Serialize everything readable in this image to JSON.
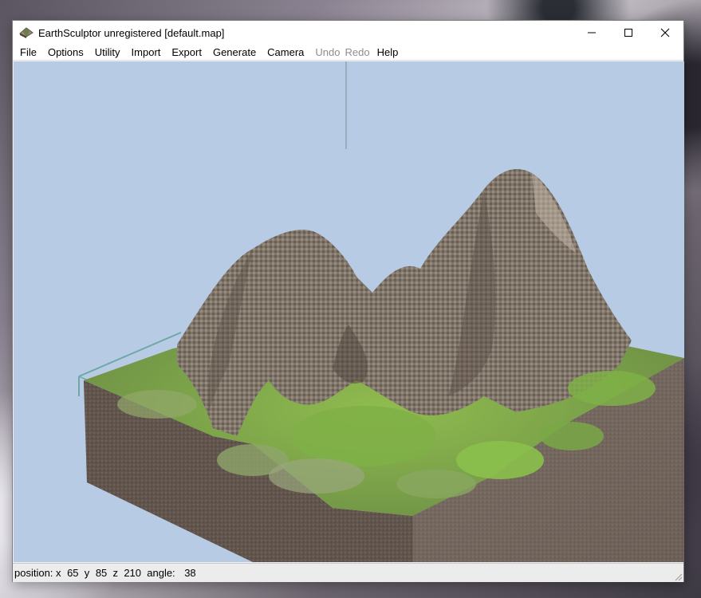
{
  "window": {
    "title": "EarthSculptor unregistered [default.map]",
    "app_icon": "earthsculptor-app-icon"
  },
  "window_controls": {
    "minimize_icon": "minimize-icon",
    "maximize_icon": "maximize-icon",
    "close_icon": "close-icon"
  },
  "menu": {
    "file": "File",
    "options": "Options",
    "utility": "Utility",
    "import": "Import",
    "export": "Export",
    "generate": "Generate",
    "camera": "Camera",
    "undo": "Undo",
    "redo": "Redo",
    "help": "Help"
  },
  "viewport": {
    "sky_color": "#b7cbe4",
    "grass_color": "#7fa84a",
    "rock_color": "#8c7f72",
    "soil_color": "#6e6158",
    "bounds_color": "#6fa7a5"
  },
  "status": {
    "position_label": "position:",
    "x_label": "x",
    "x_value": "65",
    "y_label": "y",
    "y_value": "85",
    "z_label": "z",
    "z_value": "210",
    "angle_label": "angle:",
    "angle_value": "38"
  }
}
